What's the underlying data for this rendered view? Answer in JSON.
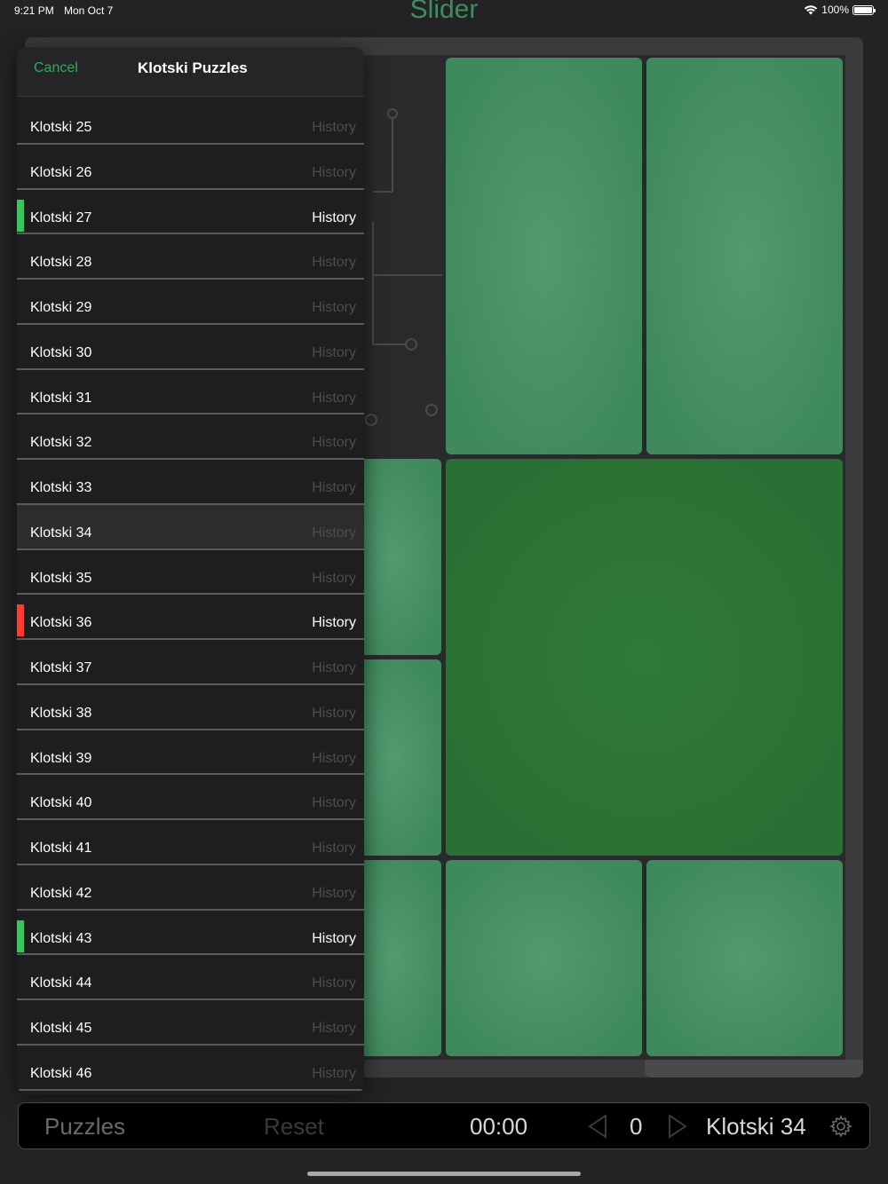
{
  "status": {
    "time": "9:21 PM",
    "date": "Mon Oct 7",
    "battery": "100%"
  },
  "app": {
    "title": "Slider"
  },
  "colors": {
    "accent": "#34a85a",
    "tile": "#3f8a5d",
    "big_tile": "#2a6f33",
    "marker_green": "#34c759",
    "marker_red": "#ff3b30"
  },
  "popover": {
    "cancel_label": "Cancel",
    "title": "Klotski Puzzles",
    "items": [
      {
        "label": "Klotski 25",
        "history": "History",
        "marker": "none",
        "history_active": false
      },
      {
        "label": "Klotski 26",
        "history": "History",
        "marker": "none",
        "history_active": false
      },
      {
        "label": "Klotski 27",
        "history": "History",
        "marker": "green",
        "history_active": true
      },
      {
        "label": "Klotski 28",
        "history": "History",
        "marker": "none",
        "history_active": false
      },
      {
        "label": "Klotski 29",
        "history": "History",
        "marker": "none",
        "history_active": false
      },
      {
        "label": "Klotski 30",
        "history": "History",
        "marker": "none",
        "history_active": false
      },
      {
        "label": "Klotski 31",
        "history": "History",
        "marker": "none",
        "history_active": false
      },
      {
        "label": "Klotski 32",
        "history": "History",
        "marker": "none",
        "history_active": false
      },
      {
        "label": "Klotski 33",
        "history": "History",
        "marker": "none",
        "history_active": false
      },
      {
        "label": "Klotski 34",
        "history": "History",
        "marker": "none",
        "history_active": false,
        "selected": true
      },
      {
        "label": "Klotski 35",
        "history": "History",
        "marker": "none",
        "history_active": false
      },
      {
        "label": "Klotski 36",
        "history": "History",
        "marker": "red",
        "history_active": true
      },
      {
        "label": "Klotski 37",
        "history": "History",
        "marker": "none",
        "history_active": false
      },
      {
        "label": "Klotski 38",
        "history": "History",
        "marker": "none",
        "history_active": false
      },
      {
        "label": "Klotski 39",
        "history": "History",
        "marker": "none",
        "history_active": false
      },
      {
        "label": "Klotski 40",
        "history": "History",
        "marker": "none",
        "history_active": false
      },
      {
        "label": "Klotski 41",
        "history": "History",
        "marker": "none",
        "history_active": false
      },
      {
        "label": "Klotski 42",
        "history": "History",
        "marker": "none",
        "history_active": false
      },
      {
        "label": "Klotski 43",
        "history": "History",
        "marker": "green",
        "history_active": true
      },
      {
        "label": "Klotski 44",
        "history": "History",
        "marker": "none",
        "history_active": false
      },
      {
        "label": "Klotski 45",
        "history": "History",
        "marker": "none",
        "history_active": false
      },
      {
        "label": "Klotski 46",
        "history": "History",
        "marker": "none",
        "history_active": false
      }
    ]
  },
  "toolbar": {
    "puzzles_label": "Puzzles",
    "reset_label": "Reset",
    "timer": "00:00",
    "move_count": "0",
    "puzzle_name": "Klotski 34"
  }
}
